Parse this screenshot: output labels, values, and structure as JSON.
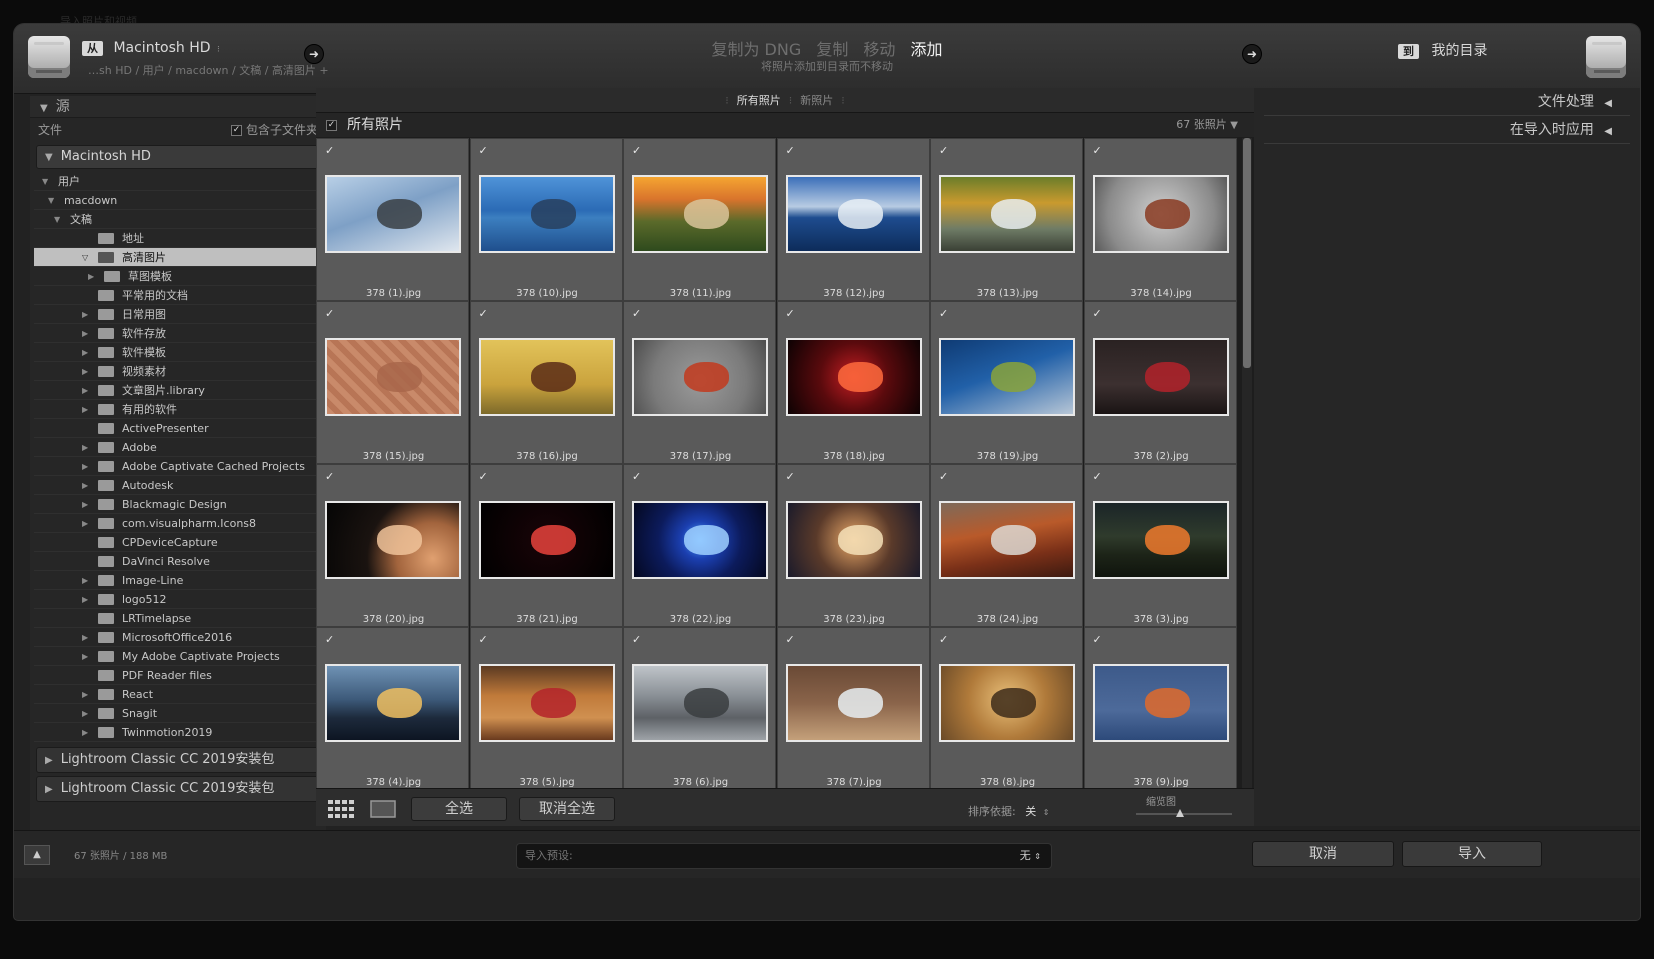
{
  "window_title": "导入照片和视频",
  "source": {
    "from_badge": "从",
    "drive": "Macintosh HD",
    "path": "…sh HD / 用户 / macdown / 文稿 / 高清图片 +"
  },
  "modes": {
    "dng": "复制为 DNG",
    "copy": "复制",
    "move": "移动",
    "add": "添加",
    "subtitle": "将照片添加到目录而不移动"
  },
  "dest": {
    "to_badge": "到",
    "label": "我的目录"
  },
  "left": {
    "header": "源",
    "files_label": "文件",
    "include_sub": "包含子文件夹",
    "drive_header": "Macintosh HD",
    "tree": [
      {
        "label": "用户",
        "depth": 0,
        "arrow": "▼",
        "folder": false,
        "sel": false
      },
      {
        "label": "macdown",
        "depth": 1,
        "arrow": "▼",
        "folder": false,
        "sel": false
      },
      {
        "label": "文稿",
        "depth": 2,
        "arrow": "▼",
        "folder": false,
        "sel": false
      },
      {
        "label": "地址",
        "depth": 3,
        "arrow": "",
        "folder": true,
        "sel": false
      },
      {
        "label": "高清图片",
        "depth": 3,
        "arrow": "▽",
        "folder": true,
        "sel": true
      },
      {
        "label": "草图模板",
        "depth": 4,
        "arrow": "▶",
        "folder": true,
        "sel": false
      },
      {
        "label": "平常用的文档",
        "depth": 3,
        "arrow": "",
        "folder": true,
        "sel": false
      },
      {
        "label": "日常用图",
        "depth": 3,
        "arrow": "▶",
        "folder": true,
        "sel": false
      },
      {
        "label": "软件存放",
        "depth": 3,
        "arrow": "▶",
        "folder": true,
        "sel": false
      },
      {
        "label": "软件模板",
        "depth": 3,
        "arrow": "▶",
        "folder": true,
        "sel": false
      },
      {
        "label": "视频素材",
        "depth": 3,
        "arrow": "▶",
        "folder": true,
        "sel": false
      },
      {
        "label": "文章图片.library",
        "depth": 3,
        "arrow": "▶",
        "folder": true,
        "sel": false
      },
      {
        "label": "有用的软件",
        "depth": 3,
        "arrow": "▶",
        "folder": true,
        "sel": false
      },
      {
        "label": "ActivePresenter",
        "depth": 3,
        "arrow": "",
        "folder": true,
        "sel": false
      },
      {
        "label": "Adobe",
        "depth": 3,
        "arrow": "▶",
        "folder": true,
        "sel": false
      },
      {
        "label": "Adobe Captivate Cached Projects",
        "depth": 3,
        "arrow": "▶",
        "folder": true,
        "sel": false
      },
      {
        "label": "Autodesk",
        "depth": 3,
        "arrow": "▶",
        "folder": true,
        "sel": false
      },
      {
        "label": "Blackmagic Design",
        "depth": 3,
        "arrow": "▶",
        "folder": true,
        "sel": false
      },
      {
        "label": "com.visualpharm.Icons8",
        "depth": 3,
        "arrow": "▶",
        "folder": true,
        "sel": false
      },
      {
        "label": "CPDeviceCapture",
        "depth": 3,
        "arrow": "",
        "folder": true,
        "sel": false
      },
      {
        "label": "DaVinci Resolve",
        "depth": 3,
        "arrow": "",
        "folder": true,
        "sel": false
      },
      {
        "label": "Image-Line",
        "depth": 3,
        "arrow": "▶",
        "folder": true,
        "sel": false
      },
      {
        "label": "logo512",
        "depth": 3,
        "arrow": "▶",
        "folder": true,
        "sel": false
      },
      {
        "label": "LRTimelapse",
        "depth": 3,
        "arrow": "",
        "folder": true,
        "sel": false
      },
      {
        "label": "MicrosoftOffice2016",
        "depth": 3,
        "arrow": "▶",
        "folder": true,
        "sel": false
      },
      {
        "label": "My Adobe Captivate Projects",
        "depth": 3,
        "arrow": "▶",
        "folder": true,
        "sel": false
      },
      {
        "label": "PDF Reader files",
        "depth": 3,
        "arrow": "",
        "folder": true,
        "sel": false
      },
      {
        "label": "React",
        "depth": 3,
        "arrow": "▶",
        "folder": true,
        "sel": false
      },
      {
        "label": "Snagit",
        "depth": 3,
        "arrow": "▶",
        "folder": true,
        "sel": false
      },
      {
        "label": "Twinmotion2019",
        "depth": 3,
        "arrow": "▶",
        "folder": true,
        "sel": false
      }
    ],
    "volumes": [
      "Lightroom Classic CC 2019安装包",
      "Lightroom Classic CC 2019安装包"
    ]
  },
  "center": {
    "tab_all": "所有照片",
    "tab_new": "新照片",
    "bar_label": "所有照片",
    "count": "67 张照片",
    "photos": [
      {
        "name": "378 (1).jpg",
        "bg": "linear-gradient(160deg,#b8cfe6 0%,#7ea0c6 45%,#dfe6ee 100%)",
        "fg": "#3a3f44"
      },
      {
        "name": "378 (10).jpg",
        "bg": "linear-gradient(180deg,#4f93d8 0%,#2b6bb5 45%,#3c7fc0 55%,#1f4f8d 100%)",
        "fg": "#28405e"
      },
      {
        "name": "378 (11).jpg",
        "bg": "linear-gradient(180deg,#f5a531 0%,#d9742c 30%,#5b6a2a 60%,#2e4a1d 100%)",
        "fg": "#d9c49a"
      },
      {
        "name": "378 (12).jpg",
        "bg": "linear-gradient(180deg,#3b6fb9 0%,#b8cce3 40%,#1e4c8f 55%,#0d2c5a 100%)",
        "fg": "#e8eef5"
      },
      {
        "name": "378 (13).jpg",
        "bg": "linear-gradient(180deg,#6b7d2a 0%,#c99a2e 35%,#6f7c66 70%,#3a4035 100%)",
        "fg": "#e6ecef"
      },
      {
        "name": "378 (14).jpg",
        "bg": "radial-gradient(circle at 50% 50%,#cfcfcf 0%,#8b8b8b 70%,#5a5a5a 100%)",
        "fg": "#8a3b22"
      },
      {
        "name": "378 (15).jpg",
        "bg": "repeating-linear-gradient(45deg,#c98a6a 0 6px,#b87556 6px 12px)",
        "fg": "#a8664a"
      },
      {
        "name": "378 (16).jpg",
        "bg": "linear-gradient(180deg,#e2c35a 0%,#caa33d 60%,#7d6a2a 100%)",
        "fg": "#5a2c16"
      },
      {
        "name": "378 (17).jpg",
        "bg": "radial-gradient(circle at 50% 55%,#9b9b9b 0%,#7a7a7a 60%,#4d4d4d 100%)",
        "fg": "#c23a1d"
      },
      {
        "name": "378 (18).jpg",
        "bg": "radial-gradient(circle at 50% 50%,#c41e23 0%,#5a0a0d 45%,#0d0203 100%)",
        "fg": "#ff6b3d"
      },
      {
        "name": "378 (19).jpg",
        "bg": "linear-gradient(160deg,#0f3b74 0%,#2160a8 45%,#b7c6d6 100%)",
        "fg": "#8aa33a"
      },
      {
        "name": "378 (2).jpg",
        "bg": "linear-gradient(180deg,#2a2222 0%,#3c3030 60%,#1a1414 100%)",
        "fg": "#b3222a"
      },
      {
        "name": "378 (20).jpg",
        "bg": "radial-gradient(circle at 80% 75%,#e0a070 0%,#a2643d 30%,#1a1310 55%,#050505 100%)",
        "fg": "#f0c39a"
      },
      {
        "name": "378 (21).jpg",
        "bg": "radial-gradient(circle at 50% 50%,#1a0408 0%,#000 100%)",
        "fg": "#e8433c"
      },
      {
        "name": "378 (22).jpg",
        "bg": "radial-gradient(circle at 50% 50%,#4ea2ff 0%,#1b3fb0 25%,#0c1b5c 55%,#040820 100%)",
        "fg": "#9fd0ff"
      },
      {
        "name": "378 (23).jpg",
        "bg": "radial-gradient(circle at 50% 50%,#e9a868 0%,#5a3a2a 50%,#1a1a2a 100%)",
        "fg": "#f5e0b8"
      },
      {
        "name": "378 (24).jpg",
        "bg": "linear-gradient(170deg,#7e6a5a 0%,#b95a2a 40%,#7a3018 70%,#3d1a10 100%)",
        "fg": "#dcd8d2"
      },
      {
        "name": "378 (3).jpg",
        "bg": "linear-gradient(180deg,#1b2528 0%,#2f3b2c 45%,#1d2418 70%,#0f140d 100%)",
        "fg": "#f07a2d"
      },
      {
        "name": "378 (4).jpg",
        "bg": "linear-gradient(180deg,#6f92b4 0%,#3d5a7a 45%,#1d2a3c 70%,#0d1522 100%)",
        "fg": "#f0c060"
      },
      {
        "name": "378 (5).jpg",
        "bg": "linear-gradient(180deg,#5b3a22 0%,#c07a3a 40%,#d09050 70%,#6a3a1e 100%)",
        "fg": "#b4232a"
      },
      {
        "name": "378 (6).jpg",
        "bg": "linear-gradient(180deg,#bfc4c9 0%,#8a9096 40%,#5d6166 70%,#9ea3a8 100%)",
        "fg": "#3a3d40"
      },
      {
        "name": "378 (7).jpg",
        "bg": "linear-gradient(180deg,#6a4a36 0%,#8a644a 50%,#c4a07a 100%)",
        "fg": "#e8eef2"
      },
      {
        "name": "378 (8).jpg",
        "bg": "radial-gradient(circle at 50% 45%,#e9c07a 0%,#b07a3a 50%,#6a4a28 100%)",
        "fg": "#3d2c1a"
      },
      {
        "name": "378 (9).jpg",
        "bg": "linear-gradient(180deg,#3d5a8a 0%,#4d6a9a 60%,#2d4a7a 100%)",
        "fg": "#e06a2a"
      }
    ],
    "select_all": "全选",
    "deselect_all": "取消全选",
    "sort_label": "排序依据:",
    "sort_value": "关",
    "thumb_label": "缩览图"
  },
  "right": {
    "file_handling": "文件处理",
    "apply_on_import": "在导入时应用"
  },
  "bottom": {
    "stats": "67 张照片 / 188 MB",
    "preset_label": "导入预设:",
    "preset_value": "无",
    "cancel": "取消",
    "import": "导入"
  }
}
